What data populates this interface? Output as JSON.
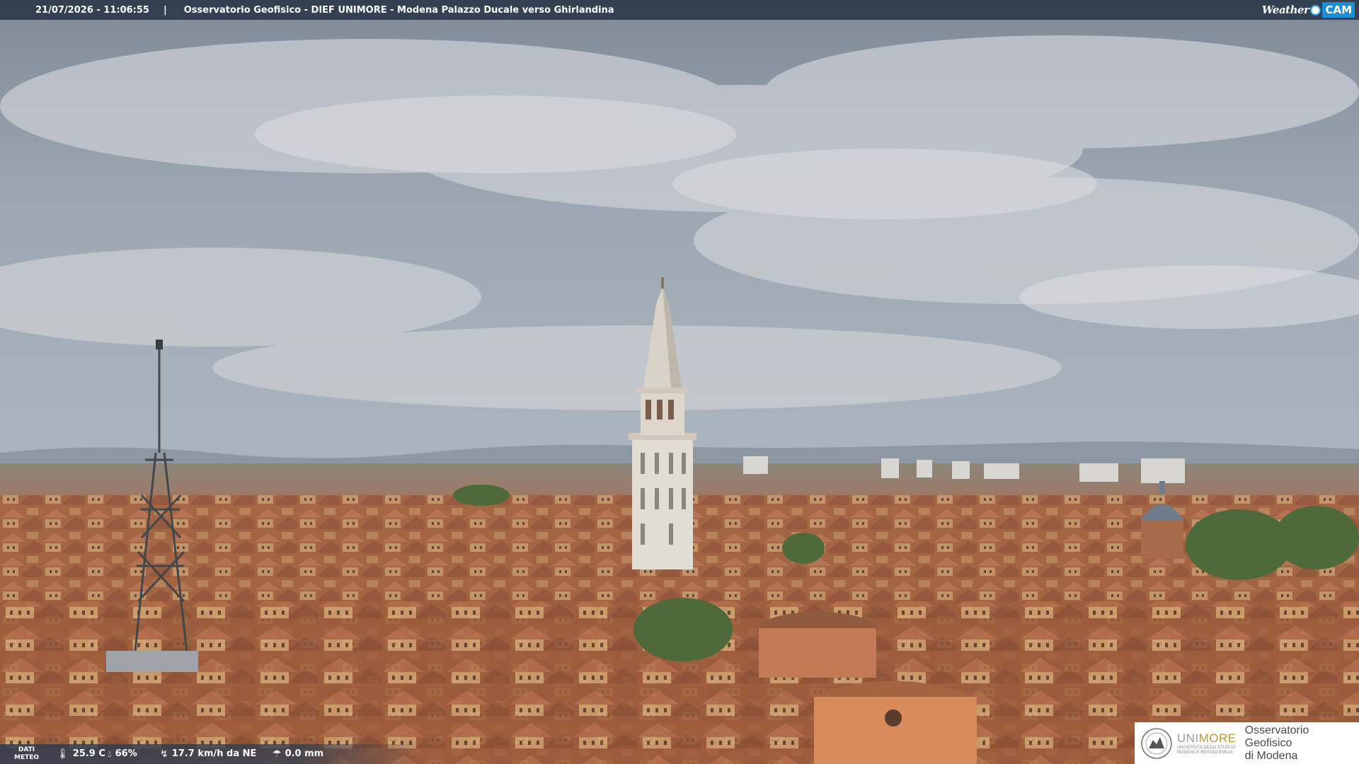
{
  "header": {
    "datetime": "21/07/2026 - 11:06:55",
    "separator": "|",
    "caption": "Osservatorio Geofisico - DIEF UNIMORE - Modena Palazzo Ducale verso Ghirlandina",
    "brand_part1": "Weather",
    "brand_part2": "CAM"
  },
  "weather": {
    "label_line1": "DATI",
    "label_line2": "METEO",
    "temperature": "25.9 C",
    "temperature_icon": "thermometer-icon",
    "humidity": "66%",
    "humidity_icon": "droplet-icon",
    "wind": "17.7 km/h da NE",
    "wind_icon": "wind-icon",
    "rain": "0.0 mm",
    "rain_icon": "rain-gauge-icon"
  },
  "logo": {
    "org_prefix": "UNI",
    "org_suffix": "MORE",
    "org_sub_line1": "UNIVERSITÀ DEGLI STUDI DI",
    "org_sub_line2": "MODENA E REGGIO EMILIA",
    "obs_line1": "Osservatorio Geofisico",
    "obs_line2": "di Modena"
  },
  "colors": {
    "sky": "#a9b3bd",
    "roofs": "#a4633f",
    "bar": "#283748",
    "brand_blue": "#1b8fd6",
    "unimore_gold": "#c8962a"
  }
}
